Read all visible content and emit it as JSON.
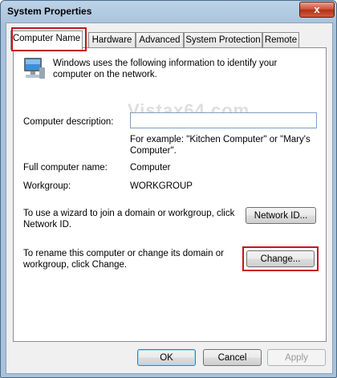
{
  "window": {
    "title": "System Properties",
    "close_glyph": "x"
  },
  "tabs": [
    {
      "label": "Computer Name",
      "active": true
    },
    {
      "label": "Hardware",
      "active": false
    },
    {
      "label": "Advanced",
      "active": false
    },
    {
      "label": "System Protection",
      "active": false
    },
    {
      "label": "Remote",
      "active": false
    }
  ],
  "intro": "Windows uses the following information to identify your computer on the network.",
  "watermark": "Vistax64.com",
  "description": {
    "label": "Computer description:",
    "value": "",
    "example": "For example: \"Kitchen Computer\" or \"Mary's Computer\"."
  },
  "full_name": {
    "label": "Full computer name:",
    "value": "Computer"
  },
  "workgroup": {
    "label": "Workgroup:",
    "value": "WORKGROUP"
  },
  "network_id": {
    "text": "To use a wizard to join a domain or workgroup, click Network ID.",
    "button": "Network ID..."
  },
  "rename": {
    "text": "To rename this computer or change its domain or workgroup, click Change.",
    "button": "Change..."
  },
  "footer": {
    "ok": "OK",
    "cancel": "Cancel",
    "apply": "Apply"
  },
  "highlight_color": "#c4161c",
  "icons": {
    "computer": "computer-icon",
    "close": "close-icon"
  }
}
